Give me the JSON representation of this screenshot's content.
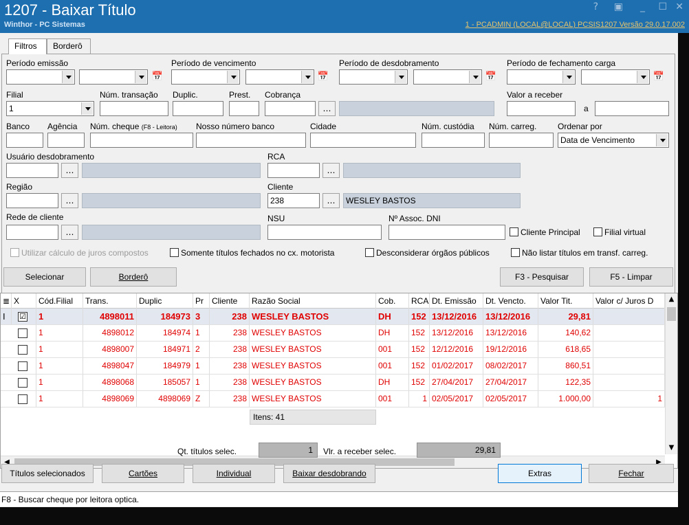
{
  "titlebar": {
    "title": "1207 - Baixar Título",
    "subtitle": "Winthor - PC Sistemas",
    "right_info": "1 - PCADMIN (LOCAL@LOCAL)  PCSIS1207  Versão  29.0.17.002"
  },
  "tabs": [
    "Filtros",
    "Borderô"
  ],
  "filters": {
    "periodo_emissao": "Período emissão",
    "periodo_vencimento": "Período de vencimento",
    "periodo_desdobramento": "Período de desdobramento",
    "periodo_fechamento": "Período de fechamento carga",
    "filial": "Filial",
    "filial_value": "1",
    "num_transacao": "Núm. transação",
    "duplic": "Duplic.",
    "prest": "Prest.",
    "cobranca": "Cobrança",
    "valor_receber": "Valor a receber",
    "a": "a",
    "banco": "Banco",
    "agencia": "Agência",
    "num_cheque": "Núm. cheque",
    "num_cheque_hint": "(F8 - Leitora)",
    "nosso_numero": "Nosso número banco",
    "cidade": "Cidade",
    "num_custodia": "Núm. custódia",
    "num_carreg": "Núm. carreg.",
    "ordenar_por": "Ordenar por",
    "ordenar_value": "Data de Vencimento",
    "usuario_desdobramento": "Usuário desdobramento",
    "rca": "RCA",
    "regiao": "Região",
    "cliente": "Cliente",
    "cliente_code": "238",
    "cliente_name": "WESLEY BASTOS",
    "rede_cliente": "Rede de cliente",
    "nsu": "NSU",
    "assoc_dni": "Nº Assoc. DNI",
    "cliente_principal": "Cliente Principal",
    "filial_virtual": "Filial virtual",
    "juros_compostos": "Utilizar cálculo de juros compostos",
    "somente_fechados": "Somente títulos fechados no cx. motorista",
    "desconsiderar_orgaos": "Desconsiderar órgãos públicos",
    "nao_listar": "Não listar títulos em transf. carreg."
  },
  "actions": {
    "selecionar": "Selecionar",
    "bordero": "Borderô",
    "pesquisar": "F3 - Pesquisar",
    "limpar": "F5 - Limpar"
  },
  "grid": {
    "columns": [
      "X",
      "Cód.Filial",
      "Trans.",
      "Duplic",
      "Pr",
      "Cliente",
      "Razão Social",
      "Cob.",
      "RCA",
      "Dt. Emissão",
      "Dt. Vencto.",
      "Valor Tit.",
      "Valor c/ Juros D"
    ],
    "rows": [
      {
        "checked": "☑",
        "filial": "1",
        "trans": "4898011",
        "duplic": "184973",
        "pr": "3",
        "cliente": "238",
        "razao": "WESLEY BASTOS",
        "cob": "DH",
        "rca": "152",
        "emissao": "13/12/2016",
        "vencto": "13/12/2016",
        "valor": "29,81",
        "juros": ""
      },
      {
        "checked": "",
        "filial": "1",
        "trans": "4898012",
        "duplic": "184974",
        "pr": "1",
        "cliente": "238",
        "razao": "WESLEY BASTOS",
        "cob": "DH",
        "rca": "152",
        "emissao": "13/12/2016",
        "vencto": "13/12/2016",
        "valor": "140,62",
        "juros": ""
      },
      {
        "checked": "",
        "filial": "1",
        "trans": "4898007",
        "duplic": "184971",
        "pr": "2",
        "cliente": "238",
        "razao": "WESLEY BASTOS",
        "cob": "001",
        "rca": "152",
        "emissao": "12/12/2016",
        "vencto": "19/12/2016",
        "valor": "618,65",
        "juros": ""
      },
      {
        "checked": "",
        "filial": "1",
        "trans": "4898047",
        "duplic": "184979",
        "pr": "1",
        "cliente": "238",
        "razao": "WESLEY BASTOS",
        "cob": "001",
        "rca": "152",
        "emissao": "01/02/2017",
        "vencto": "08/02/2017",
        "valor": "860,51",
        "juros": ""
      },
      {
        "checked": "",
        "filial": "1",
        "trans": "4898068",
        "duplic": "185057",
        "pr": "1",
        "cliente": "238",
        "razao": "WESLEY BASTOS",
        "cob": "DH",
        "rca": "152",
        "emissao": "27/04/2017",
        "vencto": "27/04/2017",
        "valor": "122,35",
        "juros": ""
      },
      {
        "checked": "",
        "filial": "1",
        "trans": "4898069",
        "duplic": "4898069",
        "pr": "Z",
        "cliente": "238",
        "razao": "WESLEY BASTOS",
        "cob": "001",
        "rca": "1",
        "emissao": "02/05/2017",
        "vencto": "02/05/2017",
        "valor": "1.000,00",
        "juros": "1"
      }
    ],
    "itens": "Itens: 41"
  },
  "summary": {
    "qt_label": "Qt. títulos selec.",
    "qt_value": "1",
    "vlr_label": "Vlr. a receber selec.",
    "vlr_value": "29,81"
  },
  "bottom_buttons": {
    "titulos": "Títulos selecionados",
    "cartoes": "Cartões",
    "individual": "Individual",
    "baixar": "Baixar desdobrando",
    "extras": "Extras",
    "fechar": "Fechar"
  },
  "status": "F8 - Buscar cheque por leitora optica."
}
